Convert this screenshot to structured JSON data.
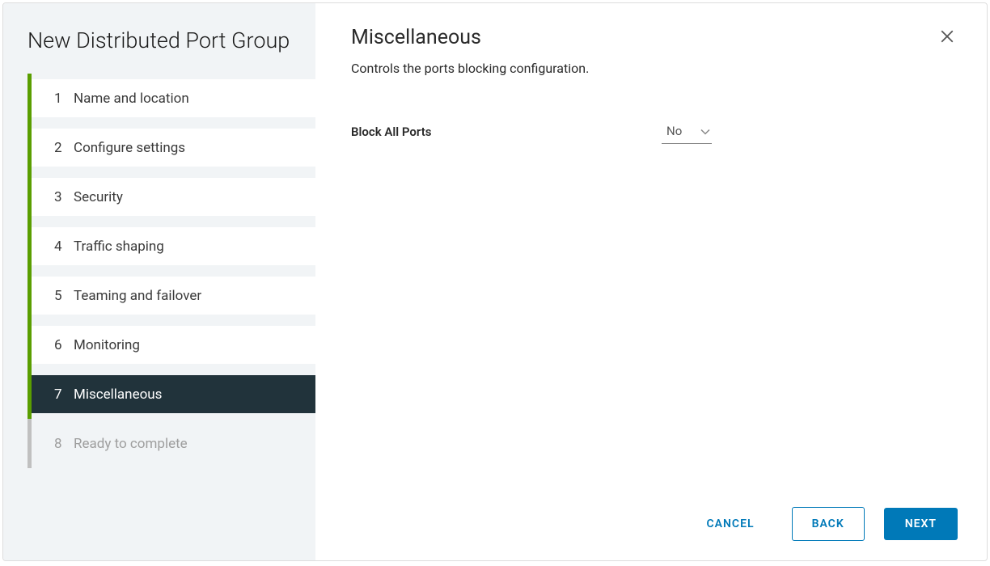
{
  "sidebar": {
    "title": "New Distributed Port Group",
    "steps": [
      {
        "num": "1",
        "label": "Name and location",
        "state": "completed"
      },
      {
        "num": "2",
        "label": "Configure settings",
        "state": "completed"
      },
      {
        "num": "3",
        "label": "Security",
        "state": "completed"
      },
      {
        "num": "4",
        "label": "Traffic shaping",
        "state": "completed"
      },
      {
        "num": "5",
        "label": "Teaming and failover",
        "state": "completed"
      },
      {
        "num": "6",
        "label": "Monitoring",
        "state": "completed"
      },
      {
        "num": "7",
        "label": "Miscellaneous",
        "state": "active"
      },
      {
        "num": "8",
        "label": "Ready to complete",
        "state": "future"
      }
    ]
  },
  "main": {
    "title": "Miscellaneous",
    "description": "Controls the ports blocking configuration.",
    "form": {
      "block_all_ports_label": "Block All Ports",
      "block_all_ports_value": "No"
    }
  },
  "footer": {
    "cancel": "CANCEL",
    "back": "BACK",
    "next": "NEXT"
  }
}
